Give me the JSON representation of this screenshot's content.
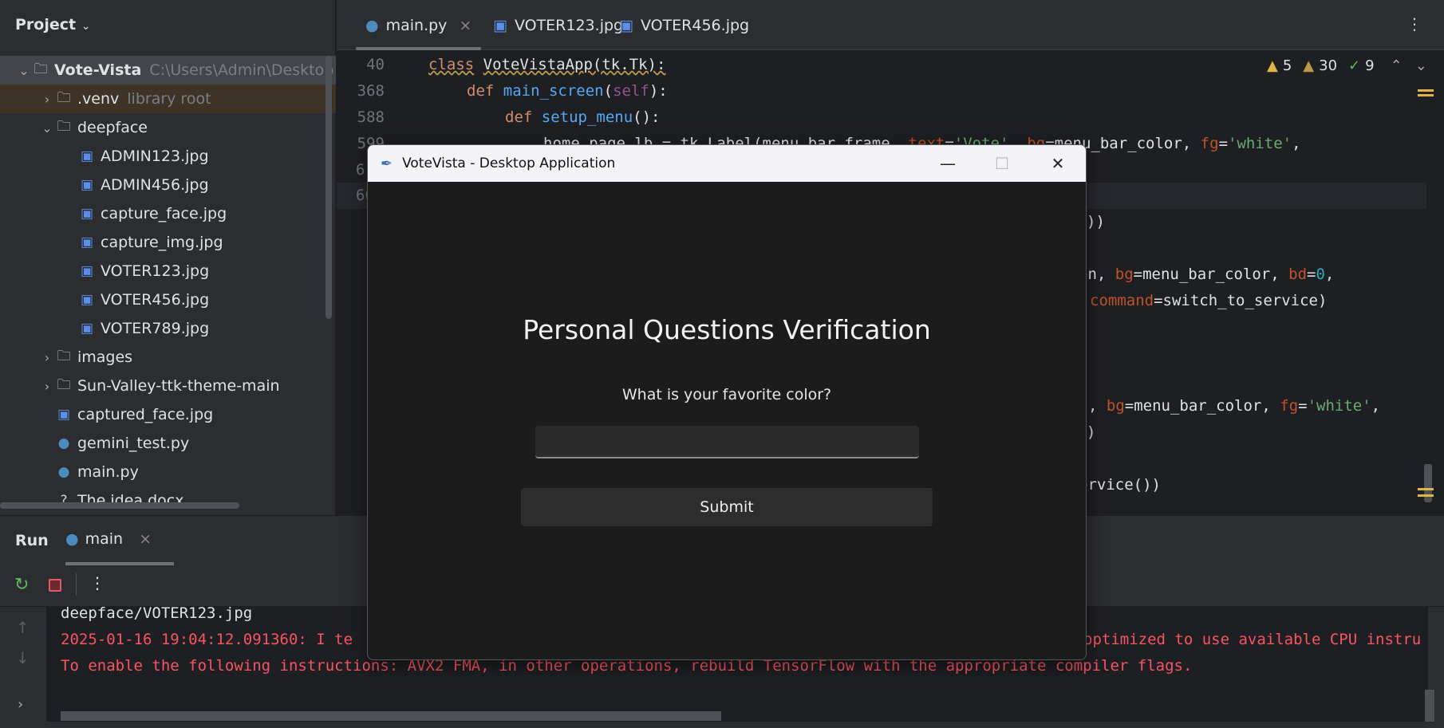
{
  "project": {
    "title": "Project",
    "tree": [
      {
        "label": "Vote-Vista",
        "extra": "C:\\Users\\Admin\\Desktop",
        "indent": 0,
        "chev": "v",
        "icon": "folder",
        "bold": true
      },
      {
        "label": ".venv",
        "extra": "library root",
        "indent": 1,
        "chev": ">",
        "icon": "folder"
      },
      {
        "label": "deepface",
        "indent": 1,
        "chev": "v",
        "icon": "folder"
      },
      {
        "label": "ADMIN123.jpg",
        "indent": 2,
        "icon": "image"
      },
      {
        "label": "ADMIN456.jpg",
        "indent": 2,
        "icon": "image"
      },
      {
        "label": "capture_face.jpg",
        "indent": 2,
        "icon": "image"
      },
      {
        "label": "capture_img.jpg",
        "indent": 2,
        "icon": "image"
      },
      {
        "label": "VOTER123.jpg",
        "indent": 2,
        "icon": "image"
      },
      {
        "label": "VOTER456.jpg",
        "indent": 2,
        "icon": "image"
      },
      {
        "label": "VOTER789.jpg",
        "indent": 2,
        "icon": "image"
      },
      {
        "label": "images",
        "indent": 1,
        "chev": ">",
        "icon": "folder"
      },
      {
        "label": "Sun-Valley-ttk-theme-main",
        "indent": 1,
        "chev": ">",
        "icon": "folder"
      },
      {
        "label": "captured_face.jpg",
        "indent": 1,
        "icon": "image"
      },
      {
        "label": "gemini_test.py",
        "indent": 1,
        "icon": "python"
      },
      {
        "label": "main.py",
        "indent": 1,
        "icon": "python"
      },
      {
        "label": "The idea.docx",
        "indent": 1,
        "icon": "unknown"
      }
    ]
  },
  "tabs": [
    {
      "label": "main.py",
      "icon": "python",
      "active": true,
      "close": "×"
    },
    {
      "label": "VOTER123.jpg",
      "icon": "image"
    },
    {
      "label": "VOTER456.jpg",
      "icon": "image"
    }
  ],
  "inspections": {
    "warnings": "5",
    "weak_warnings": "30",
    "typos": "9"
  },
  "code": {
    "line_numbers": [
      "40",
      "368",
      "588",
      "599",
      "6",
      "60"
    ],
    "l40": [
      "class",
      "VoteVistaApp(tk.Tk):"
    ],
    "l368": [
      "def",
      "main_screen",
      "(",
      "self",
      "):"
    ],
    "l588": [
      "def",
      "setup_menu",
      "():"
    ],
    "l599": [
      "home_page_lb = tk.Label(menu_bar_frame, ",
      "text",
      "=",
      "'Vote'",
      ", ",
      "bg",
      "=menu_bar_color, ",
      "fg",
      "=",
      "'white'",
      ","
    ],
    "frag1": "))",
    "frag2": [
      "on, ",
      "bg",
      "=menu_bar_color, ",
      "bd",
      "=",
      "0",
      ","
    ],
    "frag3": [
      "command",
      "=switch_to_service)"
    ],
    "frag4": [
      ", ",
      "bg",
      "=menu_bar_color, ",
      "fg",
      "=",
      "'white'",
      ","
    ],
    "frag5": ")",
    "frag6": "ervice())"
  },
  "run": {
    "title": "Run",
    "tab": "main",
    "close": "×",
    "lines": [
      "deepface/VOTER123.jpg",
      "2025-01-16 19:04:12.091360: I te",
      "optimized to use available CPU instru",
      "To enable the following instructions: AVX2 FMA, in other operations, rebuild TensorFlow with the appropriate compiler flags."
    ]
  },
  "dialog": {
    "title": "VoteVista - Desktop Application",
    "heading": "Personal Questions Verification",
    "question": "What is your favorite color?",
    "answer": "",
    "submit": "Submit"
  },
  "colors": {
    "error": "#f75464",
    "accent": "#56a8f5",
    "warning": "#e0b548"
  }
}
